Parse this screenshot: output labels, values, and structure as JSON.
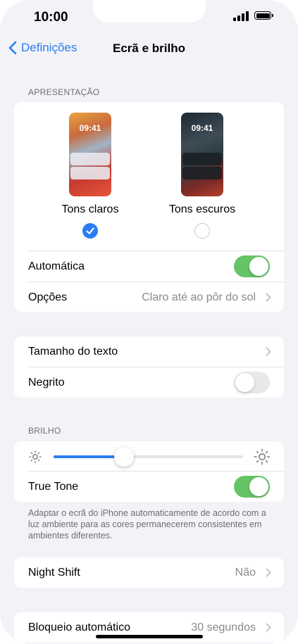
{
  "status_bar": {
    "time": "10:00"
  },
  "nav": {
    "back_label": "Definições",
    "title": "Ecrã e brilho"
  },
  "appearance": {
    "section_label": "APRESENTAÇÃO",
    "preview_time": "09:41",
    "light_label": "Tons claros",
    "dark_label": "Tons escuros",
    "selected": "light",
    "automatic_label": "Automática",
    "automatic_on": true,
    "options_label": "Opções",
    "options_value": "Claro até ao pôr do sol"
  },
  "text": {
    "text_size_label": "Tamanho do texto",
    "bold_label": "Negrito",
    "bold_on": false
  },
  "brightness": {
    "section_label": "BRILHO",
    "level": 0.37,
    "true_tone_label": "True Tone",
    "true_tone_on": true,
    "footnote": "Adaptar o ecrã do iPhone automaticamente de acordo com a luz ambiente para as cores permanecerem consistentes em ambientes diferentes."
  },
  "night_shift": {
    "label": "Night Shift",
    "value": "Não"
  },
  "auto_lock": {
    "label": "Bloqueio automático",
    "value": "30 segundos"
  },
  "colors": {
    "accent": "#2b7cf3",
    "toggle_on": "#65c466"
  }
}
